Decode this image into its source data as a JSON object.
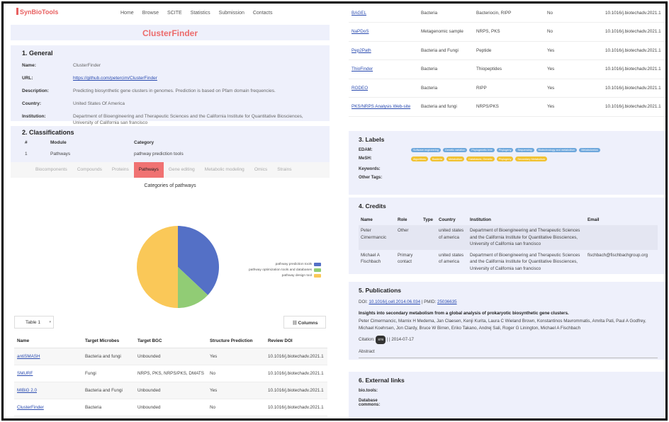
{
  "nav": {
    "logo": "SynBioTools",
    "links": [
      "Home",
      "Browse",
      "SCITE",
      "Statistics",
      "Submission",
      "Contacts"
    ]
  },
  "page_title": "ClusterFinder",
  "general": {
    "heading": "1. General",
    "name_label": "Name:",
    "name": "ClusterFinder",
    "url_label": "URL:",
    "url": "https://github.com/petercim/ClusterFinder",
    "description_label": "Description:",
    "description": "Predicting biosynthetic gene clusters in genomes. Prediction is based on Pfam domain frequencies.",
    "country_label": "Country:",
    "country": "United States Of America",
    "institution_label": "Institution:",
    "institution": "Department of Bioengineering and Therapeutic Sciences and the California Institute for Quantitative Biosciences, University of California san francisco"
  },
  "classifications": {
    "heading": "2. Classifications",
    "columns": [
      "#",
      "Module",
      "Category"
    ],
    "row": [
      "1",
      "Pathways",
      "pathway prediction tools"
    ]
  },
  "tabs": [
    "Biocomponents",
    "Compounds",
    "Proteins",
    "Pathways",
    "Gene editing",
    "Metabolic modeling",
    "Omics",
    "Strains"
  ],
  "active_tab": "Pathways",
  "chart_data": {
    "type": "pie",
    "title": "Categories of pathways",
    "labels": [
      "pathway prediction tools",
      "pathway optimization tools and databases",
      "pathway design tool"
    ],
    "values": [
      37,
      13,
      50
    ],
    "colors": [
      "#5470c6",
      "#91cc75",
      "#fac858"
    ],
    "legend_position": "right"
  },
  "table_controls": {
    "select": "Table 1",
    "columns_button": "Columns"
  },
  "tools_table": {
    "columns": [
      "Name",
      "Target Microbes",
      "Target BGC",
      "Structure Prediction",
      "Review DOI"
    ],
    "rows": [
      [
        "antiSMASH",
        "Bacteria and fungi",
        "Unbounded",
        "Yes",
        "10.1016/j.biotechadv.2021.1"
      ],
      [
        "SMURF",
        "Fungi",
        "NRPS, PKS, NRPS/PKS, DMATS",
        "No",
        "10.1016/j.biotechadv.2021.1"
      ],
      [
        "MIBiG 2.0",
        "Bacteria and Fungi",
        "Unbounded",
        "Yes",
        "10.1016/j.biotechadv.2021.1"
      ],
      [
        "ClusterFinder",
        "Bacteria",
        "Unbounded",
        "No",
        "10.1016/j.biotechadv.2021.1"
      ]
    ]
  },
  "tools_table_cont": {
    "rows": [
      [
        "BAGEL",
        "Bacteria",
        "Bacteriocin, RIPP",
        "No",
        "10.1016/j.biotechadv.2021.1"
      ],
      [
        "NaPDoS",
        "Metagenomic sample",
        "NRPS, PKS",
        "No",
        "10.1016/j.biotechadv.2021.1"
      ],
      [
        "Pep2Path",
        "Bacteria and Fungi",
        "Peptide",
        "Yes",
        "10.1016/j.biotechadv.2021.1"
      ],
      [
        "ThioFinder",
        "Bacteria",
        "Thiopeptides",
        "Yes",
        "10.1016/j.biotechadv.2021.1"
      ],
      [
        "RODEO",
        "Bacteria",
        "RIPP",
        "Yes",
        "10.1016/j.biotechadv.2021.1"
      ],
      [
        "PKS/NRPS Analysis Web-site",
        "Bacteria and fungi",
        "NRPS/PKS",
        "Yes",
        "10.1016/j.biotechadv.2021.1"
      ]
    ]
  },
  "labels": {
    "heading": "3. Labels",
    "edam_label": "EDAM:",
    "edam": [
      "Software engineering",
      "Genetic variation",
      "Phylogenetic tree",
      "Phylogeny",
      "Sequencing",
      "Biotechnology and metabolism",
      "Metabolomics"
    ],
    "mesh_label": "MeSH:",
    "mesh": [
      "Algorithms",
      "Bacteria",
      "Metabolism",
      "Databases, Genetic",
      "Phylogeny",
      "Secondary Metabolism"
    ],
    "keywords_label": "Keywords:",
    "other_tags_label": "Other Tags:"
  },
  "credits": {
    "heading": "4. Credits",
    "columns": [
      "Name",
      "Role",
      "Type",
      "Country",
      "Institution",
      "Email"
    ],
    "rows": [
      [
        "Peter Cimermancic",
        "Other",
        "",
        "united states of america",
        "Department of Bioengineering and Therapeutic Sciences and the California Institute for Quantitative Biosciences, University of California san francisco",
        ""
      ],
      [
        "Michael A Fischbach",
        "Primary contact",
        "",
        "united states of america",
        "Department of Bioengineering and Therapeutic Sciences and the California Institute for Quantitative Biosciences, University of California san francisco",
        "fischbach@fischbachgroup.org"
      ]
    ]
  },
  "publications": {
    "heading": "5. Publications",
    "doi_label": "DOI:",
    "doi": "10.1016/j.cell.2014.06.034",
    "pmid_label": "| PMID:",
    "pmid": "25036635",
    "title": "Insights into secondary metabolism from a global analysis of prokaryotic biosynthetic gene clusters.",
    "authors": "Peter Cimermancic, Marnix H Medema, Jan Claesen, Kenji Kurita, Laura C Wieland Brown, Konstantinos Mavrommatis, Amrita Pati, Paul A Godfrey, Michael Koehrsen, Jon Clardy, Bruce W Birren, Eriko Takano, Andrej Sali, Roger G Linington, Michael A Fischbach",
    "citation_label": "Citation:",
    "citation_count": "878",
    "date": "| | 2014-07-17",
    "abstract_label": "Abstract"
  },
  "external": {
    "heading": "6. External links",
    "biotools_label": "bio.tools:",
    "dbcommons_label": "Database commons:"
  }
}
